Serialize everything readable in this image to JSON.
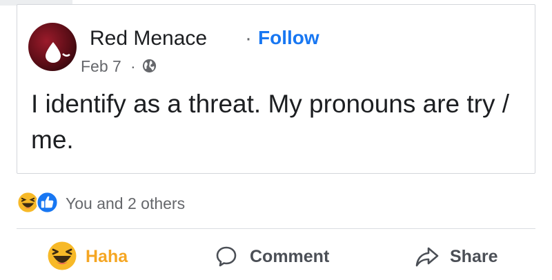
{
  "post": {
    "author": "Red Menace",
    "follow_separator": "·",
    "follow_label": "Follow",
    "date": "Feb 7",
    "date_separator": "·",
    "privacy_icon": "globe-icon",
    "text": "I identify as a threat. My pronouns are try / me."
  },
  "reactions": {
    "icons": [
      "haha-reaction-icon",
      "like-reaction-icon"
    ],
    "summary": "You and 2 others"
  },
  "actions": [
    {
      "label": "Haha",
      "icon": "haha-emoji-icon",
      "color": "#f5a623"
    },
    {
      "label": "Comment",
      "icon": "comment-bubble-icon",
      "color": "#4b4f56"
    },
    {
      "label": "Share",
      "icon": "share-arrow-icon",
      "color": "#4b4f56"
    }
  ],
  "colors": {
    "link": "#1877f2",
    "secondary_text": "#65676b",
    "haha_yellow": "#f7b928",
    "like_blue": "#1877f2"
  }
}
